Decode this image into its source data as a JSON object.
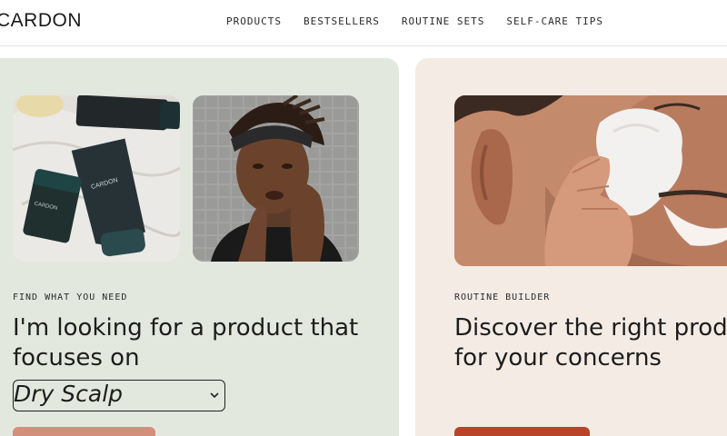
{
  "brand": {
    "logo_text": "CARDON"
  },
  "nav": {
    "items": [
      {
        "label": "PRODUCTS"
      },
      {
        "label": "BESTSELLERS"
      },
      {
        "label": "ROUTINE SETS"
      },
      {
        "label": "SELF-CARE TIPS"
      }
    ]
  },
  "left_card": {
    "eyebrow": "FIND WHAT YOU NEED",
    "headline_line1": "I'm looking for a product that",
    "headline_line2": "focuses on",
    "select_value": "Dry Scalp",
    "product_label_tube": "CARDON",
    "product_label_stick": "CARDON",
    "product_label_bottle": "CARDON"
  },
  "right_card": {
    "eyebrow": "ROUTINE BUILDER",
    "headline_line1": "Discover the right products",
    "headline_line2": "for your concerns"
  },
  "colors": {
    "left_card_bg": "#e3e8de",
    "right_card_bg": "#f4ebe5",
    "button_left": "#d38f7c",
    "button_right": "#b8452a"
  },
  "icons": {
    "select_caret": "chevron-down-icon"
  }
}
